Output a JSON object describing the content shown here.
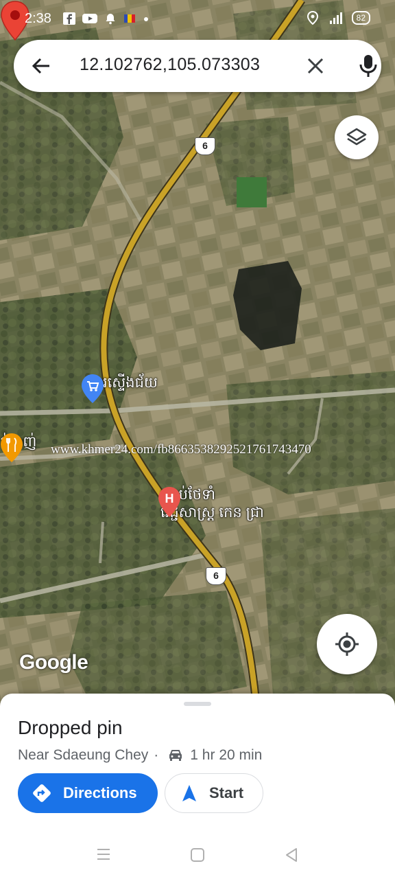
{
  "status_bar": {
    "time": "2:38",
    "battery": "82"
  },
  "search": {
    "query": "12.102762,105.073303"
  },
  "map": {
    "road_number_top": "6",
    "road_number_bottom": "6",
    "poi_market": "ផ្សារស្ទើងជ័យ",
    "poi_restaurant": "ក់ឆ្នាញ់",
    "poi_hospital_line1": "បន្ទប់ថែទាំ",
    "poi_hospital_line2": "វេជ្ជសាស្ត្រ កេន ជ្រា",
    "watermark": "www.khmer24.com/fb866353829252176174347​0",
    "attribution": "Google",
    "colors": {
      "road": "#c9a227",
      "pin": "#ea4335",
      "poi_blue": "#4285f4",
      "poi_orange": "#f29900",
      "hospital": "#e8554d"
    }
  },
  "place_sheet": {
    "title": "Dropped pin",
    "subtitle": "Near Sdaeung Chey",
    "separator": "·",
    "drive_time": "1 hr 20 min",
    "directions_label": "Directions",
    "start_label": "Start",
    "accent": "#1a73e8"
  }
}
